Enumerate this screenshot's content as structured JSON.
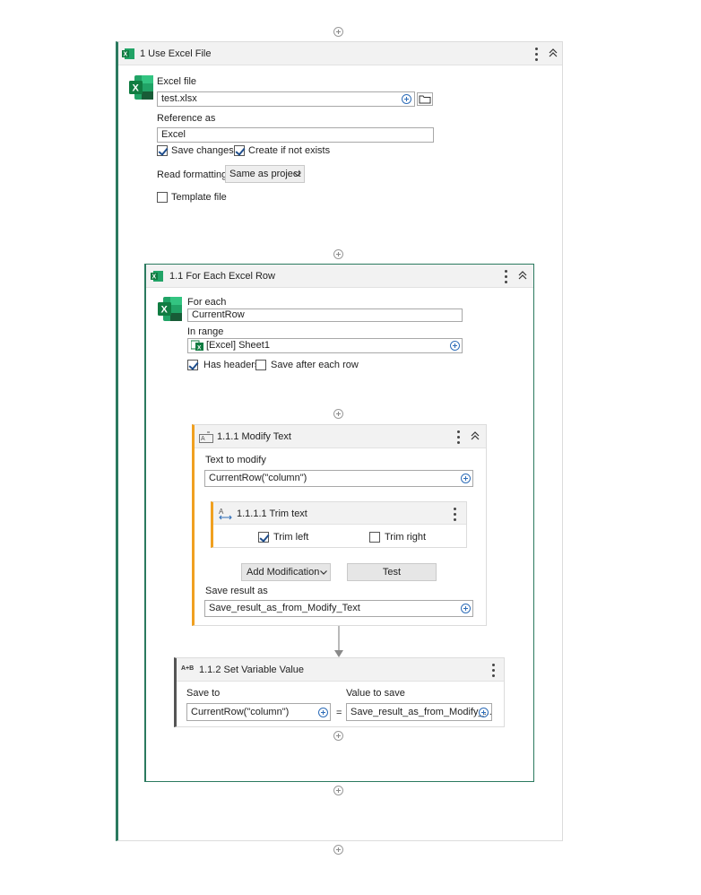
{
  "use_excel": {
    "title": "1  Use Excel File",
    "excel_file_label": "Excel file",
    "excel_file_value": "test.xlsx",
    "reference_label": "Reference as",
    "reference_value": "Excel",
    "save_changes_label": "Save changes",
    "save_changes_checked": true,
    "create_if_not_exists_label": "Create if not exists",
    "create_if_not_exists_checked": true,
    "read_formatting_label": "Read formatting",
    "read_formatting_value": "Same as project",
    "template_file_label": "Template file",
    "template_file_checked": false
  },
  "for_each": {
    "title": "1.1  For Each Excel Row",
    "for_each_label": "For each",
    "for_each_value": "CurrentRow",
    "in_range_label": "In range",
    "in_range_value": "[Excel] Sheet1",
    "has_headers_label": "Has headers",
    "has_headers_checked": true,
    "save_after_each_row_label": "Save after each row",
    "save_after_each_row_checked": false
  },
  "modify_text": {
    "title": "1.1.1  Modify Text",
    "text_to_modify_label": "Text to modify",
    "text_to_modify_value": "CurrentRow(\"column\")",
    "add_modification_label": "Add Modification",
    "test_label": "Test",
    "save_result_label": "Save result as",
    "save_result_value": "Save_result_as_from_Modify_Text"
  },
  "trim_text": {
    "title": "1.1.1.1  Trim text",
    "trim_left_label": "Trim left",
    "trim_left_checked": true,
    "trim_right_label": "Trim right",
    "trim_right_checked": false
  },
  "set_variable": {
    "title": "1.1.2  Set Variable Value",
    "icon_text": "A+B",
    "save_to_label": "Save to",
    "save_to_value": "CurrentRow(\"column\")",
    "equals": "=",
    "value_to_save_label": "Value to save",
    "value_to_save_value": "Save_result_as_from_Modify_..."
  },
  "colors": {
    "excel_green": "#1d6f42",
    "container_border": "#2b7a5f",
    "modify_accent": "#f0a020",
    "setvar_accent": "#555555",
    "plus_blue": "#2e6db8"
  },
  "icons": [
    "add-activity-icon",
    "excel-icon",
    "kebab-menu-icon",
    "collapse-chevron-icon",
    "folder-icon",
    "modify-text-icon",
    "trim-text-icon",
    "flow-arrow-icon",
    "add-value-icon",
    "dropdown-chevron-icon",
    "checkbox-icon"
  ]
}
